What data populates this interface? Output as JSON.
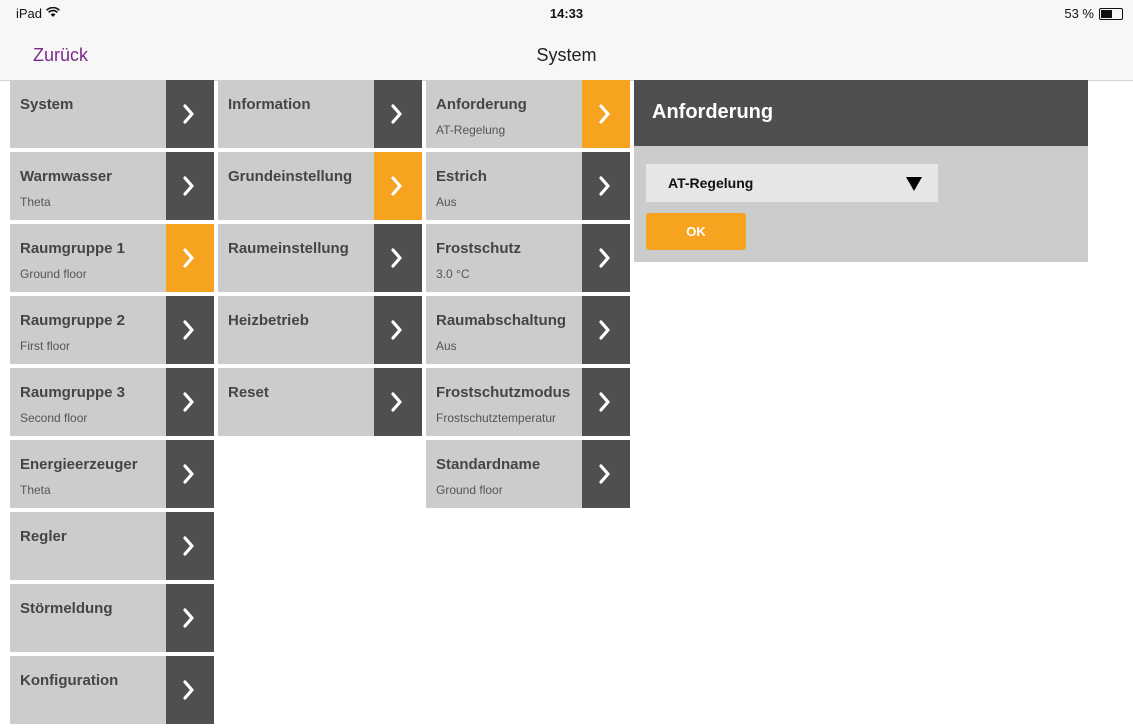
{
  "statusbar": {
    "device": "iPad",
    "time": "14:33",
    "battery_text": "53 %",
    "battery_level": 0.53
  },
  "navbar": {
    "back_label": "Zurück",
    "title": "System"
  },
  "column1": [
    {
      "label": "System",
      "sub": "",
      "active": false
    },
    {
      "label": "Warmwasser",
      "sub": "Theta",
      "active": false
    },
    {
      "label": "Raumgruppe 1",
      "sub": "Ground floor",
      "active": true
    },
    {
      "label": "Raumgruppe 2",
      "sub": "First floor",
      "active": false
    },
    {
      "label": "Raumgruppe 3",
      "sub": "Second floor",
      "active": false
    },
    {
      "label": "Energieerzeuger",
      "sub": "Theta",
      "active": false
    },
    {
      "label": "Regler",
      "sub": "",
      "active": false
    },
    {
      "label": "Störmeldung",
      "sub": "",
      "active": false
    },
    {
      "label": "Konfiguration",
      "sub": "",
      "active": false
    }
  ],
  "column2": [
    {
      "label": "Information",
      "sub": "",
      "active": false
    },
    {
      "label": "Grundeinstellung",
      "sub": "",
      "active": true
    },
    {
      "label": "Raumeinstellung",
      "sub": "",
      "active": false
    },
    {
      "label": "Heizbetrieb",
      "sub": "",
      "active": false
    },
    {
      "label": "Reset",
      "sub": "",
      "active": false
    }
  ],
  "column3": [
    {
      "label": "Anforderung",
      "sub": "AT-Regelung",
      "active": true
    },
    {
      "label": "Estrich",
      "sub": "Aus",
      "active": false
    },
    {
      "label": "Frostschutz",
      "sub": "3.0 °C",
      "active": false
    },
    {
      "label": "Raumabschaltung",
      "sub": "Aus",
      "active": false
    },
    {
      "label": "Frostschutzmodus",
      "sub": "Frostschutztemperatur",
      "active": false
    },
    {
      "label": "Standardname",
      "sub": "Ground floor",
      "active": false
    }
  ],
  "detail": {
    "title": "Anforderung",
    "selected_value": "AT-Regelung",
    "ok_label": "OK"
  },
  "colors": {
    "accent": "#f6a320",
    "arrow_bg": "#4f4f4f",
    "item_bg": "#cccccc",
    "back_link": "#7a2a88"
  },
  "icons": {
    "chevron": "chevron-right-icon",
    "caret": "caret-down-icon",
    "wifi": "wifi-icon",
    "battery": "battery-icon"
  }
}
